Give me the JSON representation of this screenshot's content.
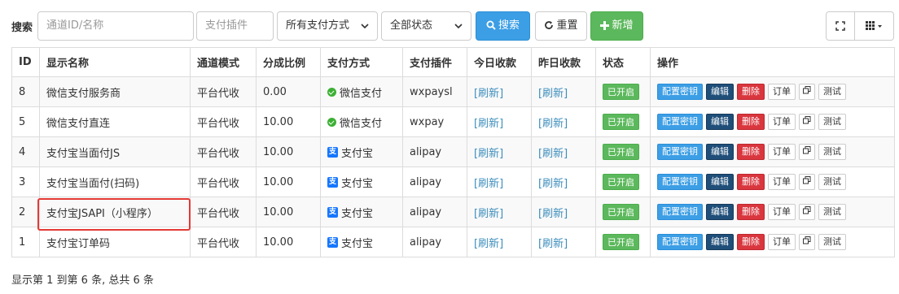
{
  "search": {
    "label": "搜索",
    "channel_placeholder": "通道ID/名称",
    "plugin_placeholder": "支付插件",
    "paytype_selected": "所有支付方式",
    "status_selected": "全部状态",
    "search_label": "搜索",
    "reset_label": "重置",
    "add_label": "新增"
  },
  "table": {
    "headers": [
      "ID",
      "显示名称",
      "通道模式",
      "分成比例",
      "支付方式",
      "支付插件",
      "今日收款",
      "昨日收款",
      "状态",
      "操作"
    ],
    "rows": [
      {
        "id": "8",
        "name": "微信支付服务商",
        "mode": "平台代收",
        "ratio": "0.00",
        "paytype": "微信支付",
        "paytype_icon": "wechat-pay-icon",
        "plugin": "wxpaysl",
        "today": "[刷新]",
        "yesterday": "[刷新]",
        "status": "已开启"
      },
      {
        "id": "5",
        "name": "微信支付直连",
        "mode": "平台代收",
        "ratio": "10.00",
        "paytype": "微信支付",
        "paytype_icon": "wechat-pay-icon",
        "plugin": "wxpay",
        "today": "[刷新]",
        "yesterday": "[刷新]",
        "status": "已开启"
      },
      {
        "id": "4",
        "name": "支付宝当面付JS",
        "mode": "平台代收",
        "ratio": "10.00",
        "paytype": "支付宝",
        "paytype_icon": "alipay-icon",
        "plugin": "alipay",
        "today": "[刷新]",
        "yesterday": "[刷新]",
        "status": "已开启"
      },
      {
        "id": "3",
        "name": "支付宝当面付(扫码)",
        "mode": "平台代收",
        "ratio": "10.00",
        "paytype": "支付宝",
        "paytype_icon": "alipay-icon",
        "plugin": "alipay",
        "today": "[刷新]",
        "yesterday": "[刷新]",
        "status": "已开启"
      },
      {
        "id": "2",
        "name": "支付宝JSAPI（小程序）",
        "mode": "平台代收",
        "ratio": "10.00",
        "paytype": "支付宝",
        "paytype_icon": "alipay-icon",
        "plugin": "alipay",
        "today": "[刷新]",
        "yesterday": "[刷新]",
        "status": "已开启"
      },
      {
        "id": "1",
        "name": "支付宝订单码",
        "mode": "平台代收",
        "ratio": "10.00",
        "paytype": "支付宝",
        "paytype_icon": "alipay-icon",
        "plugin": "alipay",
        "today": "[刷新]",
        "yesterday": "[刷新]",
        "status": "已开启"
      }
    ],
    "actions": {
      "config": "配置密钥",
      "edit": "编辑",
      "delete": "删除",
      "order": "订单",
      "test": "测试"
    }
  },
  "footer": {
    "summary": "显示第 1 到第 6 条, 总共 6 条"
  },
  "colors": {
    "primary": "#3c9ee5",
    "success": "#5cb85c",
    "danger": "#d9363e",
    "navy": "#1f4e79",
    "highlight": "#e53935"
  }
}
